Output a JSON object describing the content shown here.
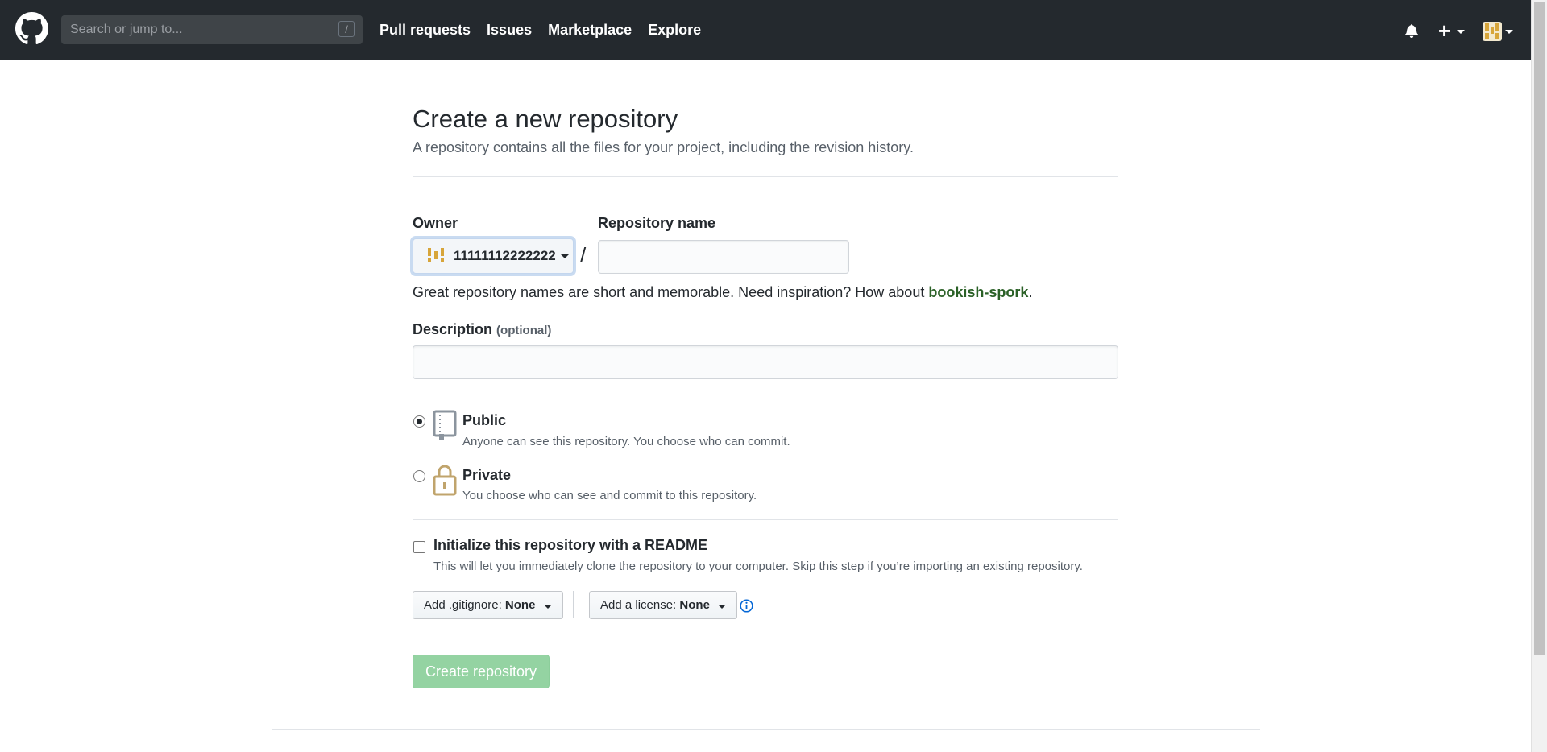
{
  "header": {
    "search_placeholder": "Search or jump to...",
    "search_shortcut": "/",
    "nav": [
      {
        "label": "Pull requests"
      },
      {
        "label": "Issues"
      },
      {
        "label": "Marketplace"
      },
      {
        "label": "Explore"
      }
    ],
    "plus_label": "+"
  },
  "page": {
    "title": "Create a new repository",
    "subtitle": "A repository contains all the files for your project, including the revision history."
  },
  "form": {
    "owner_label": "Owner",
    "owner_value": "11111112222222",
    "separator": "/",
    "repo_name_label": "Repository name",
    "repo_name_value": "",
    "hint_prefix": "Great repository names are short and memorable. Need inspiration? How about ",
    "hint_suggestion": "bookish-spork",
    "hint_suffix": ".",
    "description_label": "Description",
    "description_optional": "(optional)",
    "description_value": "",
    "visibility": {
      "selected": "public",
      "public_title": "Public",
      "public_desc": "Anyone can see this repository. You choose who can commit.",
      "private_title": "Private",
      "private_desc": "You choose who can see and commit to this repository."
    },
    "readme": {
      "checked": false,
      "label": "Initialize this repository with a README",
      "desc": "This will let you immediately clone the repository to your computer. Skip this step if you’re importing an existing repository."
    },
    "gitignore": {
      "prefix": "Add .gitignore: ",
      "value": "None"
    },
    "license": {
      "prefix": "Add a license: ",
      "value": "None"
    },
    "submit_label": "Create repository"
  },
  "colors": {
    "header_bg": "#24292e",
    "suggestion": "#2b6127",
    "submit_disabled_bg": "#94d3a2"
  }
}
